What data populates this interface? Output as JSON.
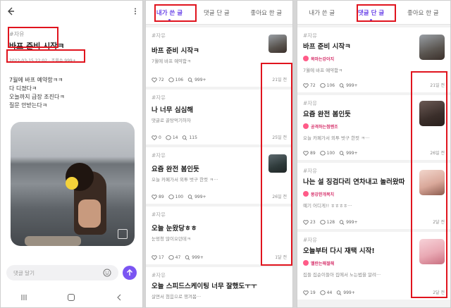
{
  "panel1": {
    "tag": "#자유",
    "title": "바프 준비 시작ㅋ",
    "meta": "2022-03-15 22:02 · 조회수 999+",
    "body_lines": [
      "7월에 바프 예약함ㅋㅋ",
      "다 디졌다ㅋ",
      "오늘까지 급장 조진다ㅋ",
      "질문 안받는다ㅋ"
    ],
    "comment_placeholder": "댓글 달기"
  },
  "tabs": [
    "내가 쓴 글",
    "댓글 단 글",
    "좋아요 한 글"
  ],
  "panel2": {
    "active_tab": 0,
    "posts": [
      {
        "tag": "#자유",
        "title": "바프 준비 시작ㅋ",
        "body": "7월에 바프 예약함ㅋ",
        "likes": "72",
        "comments": "106",
        "views": "999+",
        "time": "21일 전",
        "thumb": true
      },
      {
        "tag": "#자유",
        "title": "나 너무 심심해",
        "body": "댓글로 골탕먹기하자",
        "likes": "0",
        "comments": "14",
        "views": "115",
        "time": "25일 전",
        "thumb": false
      },
      {
        "tag": "#자유",
        "title": "요즘 완전 봄인듯",
        "body": "오늘 카페가서 외투 벗구 한컷 ㅋ···",
        "likes": "89",
        "comments": "100",
        "views": "999+",
        "time": "26일 전",
        "thumb": true
      },
      {
        "tag": "#자유",
        "title": "오늘 눈왔당ㅎㅎ",
        "body": "눈멍청 많이오던데ㅋ",
        "likes": "17",
        "comments": "47",
        "views": "999+",
        "time": "1달 전",
        "thumb": false
      },
      {
        "tag": "#자유",
        "title": "오늘 스피드스케이팅 너무 잘했도ㅜㅜ",
        "body": "살면서 첨음으로 쟁겨봄···",
        "likes": "",
        "comments": "",
        "views": "",
        "time": "",
        "thumb": false
      }
    ]
  },
  "panel3": {
    "active_tab": 1,
    "posts": [
      {
        "tag": "#자유",
        "title": "바프 준비 시작ㅋ",
        "badge": "목마는강아지",
        "body": "7월에 바프 예약함ㅋ",
        "likes": "72",
        "comments": "106",
        "views": "999+",
        "time": "21일 전"
      },
      {
        "tag": "#자유",
        "title": "요즘 완전 봄인듯",
        "badge": "공격하는첨멘조",
        "body": "오늘 카페가서 외투 벗구 한컷 ㅋ···",
        "likes": "89",
        "comments": "100",
        "views": "999+",
        "time": "26일 전"
      },
      {
        "tag": "#자유",
        "title": "나는 설 징검다리 연차내고 놀러왔따",
        "badge": "몽강한개복치",
        "body": "예기 어디게!! ㅎㅎㅎㅎ···",
        "likes": "23",
        "comments": "128",
        "views": "999+",
        "time": "2달 전"
      },
      {
        "tag": "#자유",
        "title": "오늘부터 다시 재택 시작!",
        "badge": "멜란는해절해",
        "body": "집들 집순이들아 집에서 노는법을 알려···",
        "likes": "19",
        "comments": "44",
        "views": "999+",
        "time": "2달 전"
      }
    ]
  }
}
